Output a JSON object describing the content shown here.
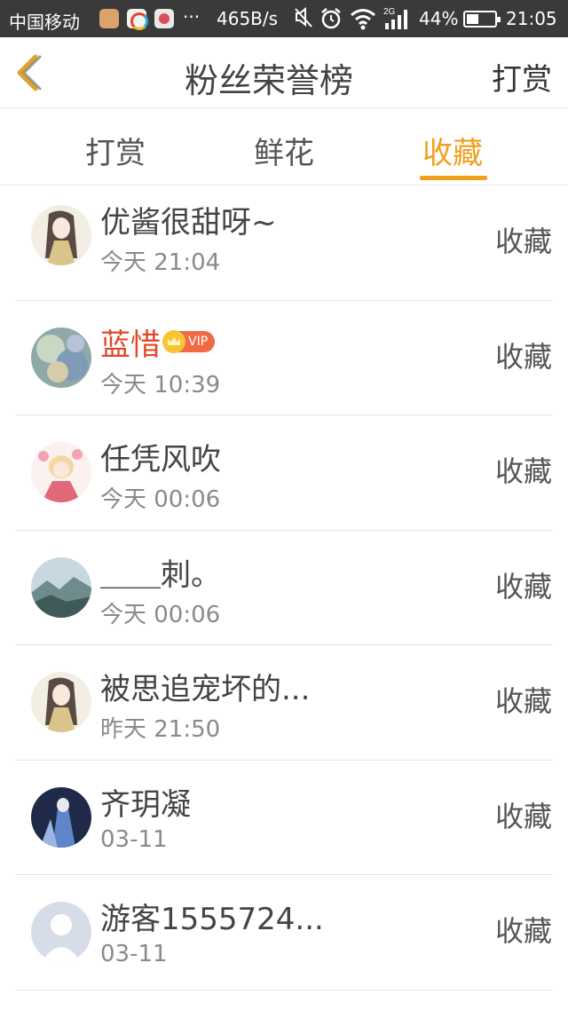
{
  "status_bar": {
    "carrier": "中国移动",
    "dots": "···",
    "net_speed": "465B/s",
    "network_type": "2G",
    "battery_percent": "44%",
    "battery_level": 0.44,
    "time": "21:05"
  },
  "header": {
    "back_icon": "chevron-left-icon",
    "title": "粉丝荣誉榜",
    "right_action": "打赏"
  },
  "tabs": [
    {
      "label": "打赏",
      "active": false
    },
    {
      "label": "鲜花",
      "active": false
    },
    {
      "label": "收藏",
      "active": true
    }
  ],
  "accent_color": "#f0a01c",
  "vip_name_color": "#e0482b",
  "vip_badge_text": "VIP",
  "list": [
    {
      "name": "优酱很甜呀~",
      "time": "今天 21:04",
      "action": "收藏",
      "vip": false,
      "avatar": "anime-girl-avatar"
    },
    {
      "name": "蓝惜",
      "time": "今天 10:39",
      "action": "收藏",
      "vip": true,
      "avatar": "blurry-art-avatar"
    },
    {
      "name": "任凭风吹",
      "time": "今天 00:06",
      "action": "收藏",
      "vip": false,
      "avatar": "anime-girl-flower-avatar"
    },
    {
      "name": "＿＿刺。",
      "time": "今天 00:06",
      "action": "收藏",
      "vip": false,
      "avatar": "mountain-landscape-avatar"
    },
    {
      "name": "被思追宠坏的...",
      "time": "昨天 21:50",
      "action": "收藏",
      "vip": false,
      "avatar": "anime-girl-avatar"
    },
    {
      "name": "齐玥凝",
      "time": "03-11",
      "action": "收藏",
      "vip": false,
      "avatar": "blue-robed-figure-avatar"
    },
    {
      "name": "游客1555724...",
      "time": "03-11",
      "action": "收藏",
      "vip": false,
      "avatar": "default-user-avatar"
    }
  ]
}
